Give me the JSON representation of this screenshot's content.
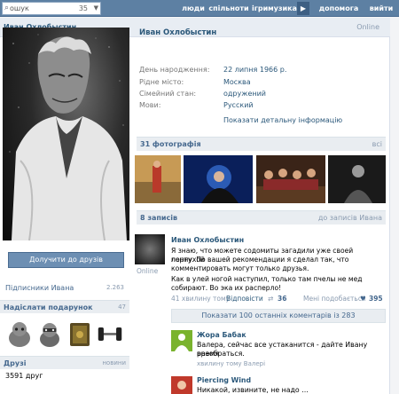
{
  "topbar": {
    "search_text": "ошук",
    "search_count": "35",
    "nav": [
      "люди",
      "спільноти",
      "ігри",
      "музика",
      "допомога",
      "вийти"
    ]
  },
  "profile": {
    "name": "Иван Охлобыстин",
    "status": "Online",
    "info": [
      {
        "key": "День народження:",
        "value": "22 липня 1966 р."
      },
      {
        "key": "Рідне місто:",
        "value": "Москва"
      },
      {
        "key": "Сімейний стан:",
        "value": "одружений"
      },
      {
        "key": "Мови:",
        "value": "Русский"
      }
    ],
    "more_info": "Показати детальну інформацію"
  },
  "sidebar": {
    "add_friend": "Долучити до друзів",
    "followers_label": "Підписники Ивана",
    "followers_count": "2.263",
    "gifts_title": "Надіслати подарунок",
    "gifts_count": "47",
    "friends_title": "Друзі",
    "friends_link": "новини",
    "friends_count": "3591 друг"
  },
  "photos": {
    "title": "31 фотографія",
    "link": "всі"
  },
  "wall": {
    "title": "8 записів",
    "link": "до записів Ивана",
    "post": {
      "author": "Иван Охлобыстин",
      "avatar_status": "Online",
      "lines": [
        "Я знаю, что можете содомиты загадили уже своей порнухой",
        "ленту. По вашей рекомендации я сделал так, что",
        "комментировать могут только друзья.",
        "Как в улей ногой наступил, только там пчелы не мед",
        "собирают. Во эка их расперло!"
      ],
      "time": "41 хвилину тому",
      "reply": "Відповісти",
      "shares": "36",
      "like_label": "Мені подобається",
      "likes": "395"
    },
    "show_comments": "Показати 100 останніх коментарів із 283",
    "comments": [
      {
        "author": "Жора Бабак",
        "lines": [
          "Валера, сейчас все устаканится - дайте Ивану время",
          "разобраться."
        ],
        "time": "хвилину тому Валері"
      },
      {
        "author": "Piercing Wind",
        "lines": [
          "Никакой, извините, не надо …"
        ],
        "time": ""
      }
    ]
  },
  "colors": {
    "topbar": "#5d80a3",
    "link": "#2b587a",
    "header_bg": "#e9edf1"
  }
}
